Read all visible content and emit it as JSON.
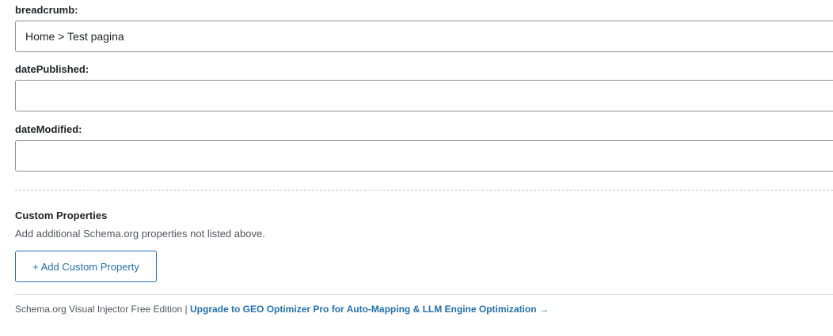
{
  "fields": [
    {
      "label": "breadcrumb:",
      "value": "Home > Test pagina",
      "placeholder": ""
    },
    {
      "label": "datePublished:",
      "value": "",
      "placeholder": ""
    },
    {
      "label": "dateModified:",
      "value": "",
      "placeholder": ""
    }
  ],
  "custom_properties": {
    "title": "Custom Properties",
    "description": "Add additional Schema.org properties not listed above.",
    "add_button_label": "+ Add Custom Property"
  },
  "footer": {
    "edition_text": "Schema.org Visual Injector Free Edition |",
    "upgrade_link_text": "Upgrade to GEO Optimizer Pro for Auto-Mapping & LLM Engine Optimization →"
  },
  "colors": {
    "accent": "#2271b1",
    "text": "#1d2327",
    "muted": "#50575e",
    "input_border": "#8c8f94"
  }
}
